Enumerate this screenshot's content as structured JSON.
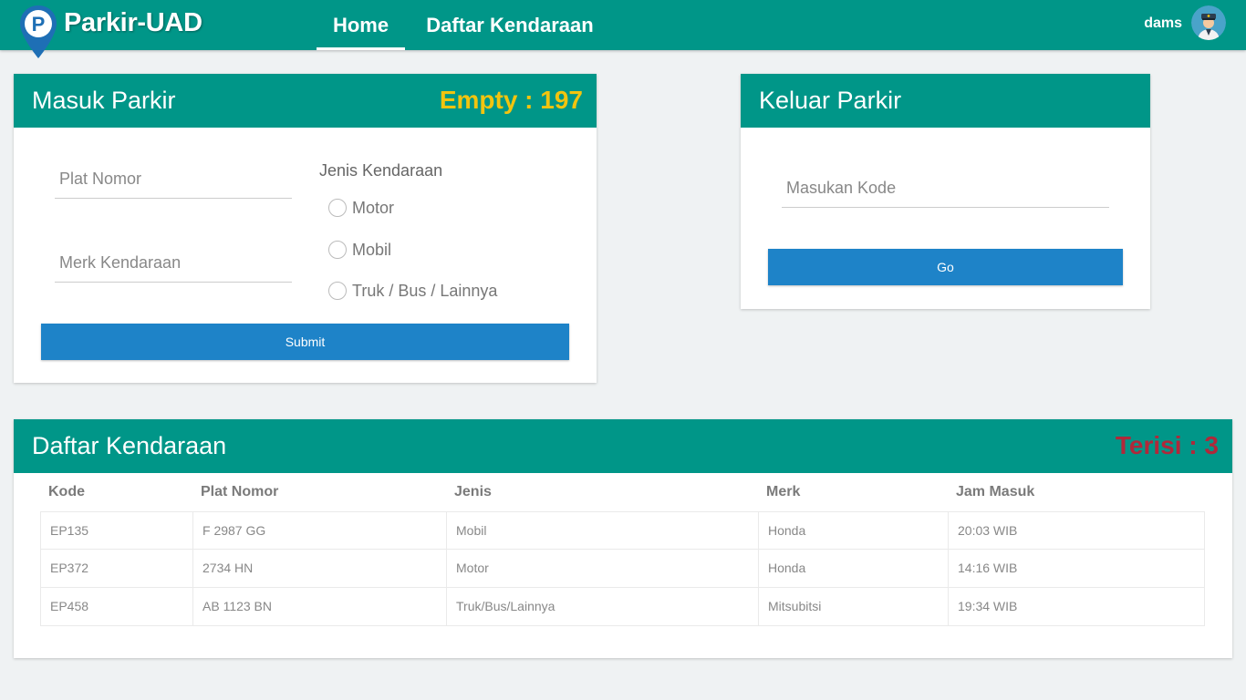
{
  "navbar": {
    "brand": "Parkir-UAD",
    "logo_letter": "P",
    "nav_home": "Home",
    "nav_daftar": "Daftar Kendaraan",
    "user_name": "dams"
  },
  "masuk": {
    "title": "Masuk Parkir",
    "empty_label": "Empty : 197",
    "plat_placeholder": "Plat Nomor",
    "merk_placeholder": "Merk Kendaraan",
    "jenis_label": "Jenis Kendaraan",
    "options": [
      "Motor",
      "Mobil",
      "Truk / Bus / Lainnya"
    ],
    "submit_label": "Submit"
  },
  "keluar": {
    "title": "Keluar Parkir",
    "kode_placeholder": "Masukan Kode",
    "go_label": "Go"
  },
  "daftar": {
    "title": "Daftar Kendaraan",
    "terisi_label": "Terisi : 3",
    "columns": [
      "Kode",
      "Plat Nomor",
      "Jenis",
      "Merk",
      "Jam Masuk"
    ],
    "rows": [
      [
        "EP135",
        "F 2987 GG",
        "Mobil",
        "Honda",
        "20:03 WIB"
      ],
      [
        "EP372",
        "2734 HN",
        "Motor",
        "Honda",
        "14:16 WIB"
      ],
      [
        "EP458",
        "AB 1123 BN",
        "Truk/Bus/Lainnya",
        "Mitsubitsi",
        "19:34 WIB"
      ]
    ]
  },
  "colors": {
    "primary": "#009688",
    "button": "#1e83c8",
    "empty": "#f2c40f",
    "terisi": "#b0283a",
    "logo": "#1e6fb5"
  },
  "icons": [
    "parking-pin-logo-icon",
    "user-avatar-icon",
    "radio-icon"
  ]
}
